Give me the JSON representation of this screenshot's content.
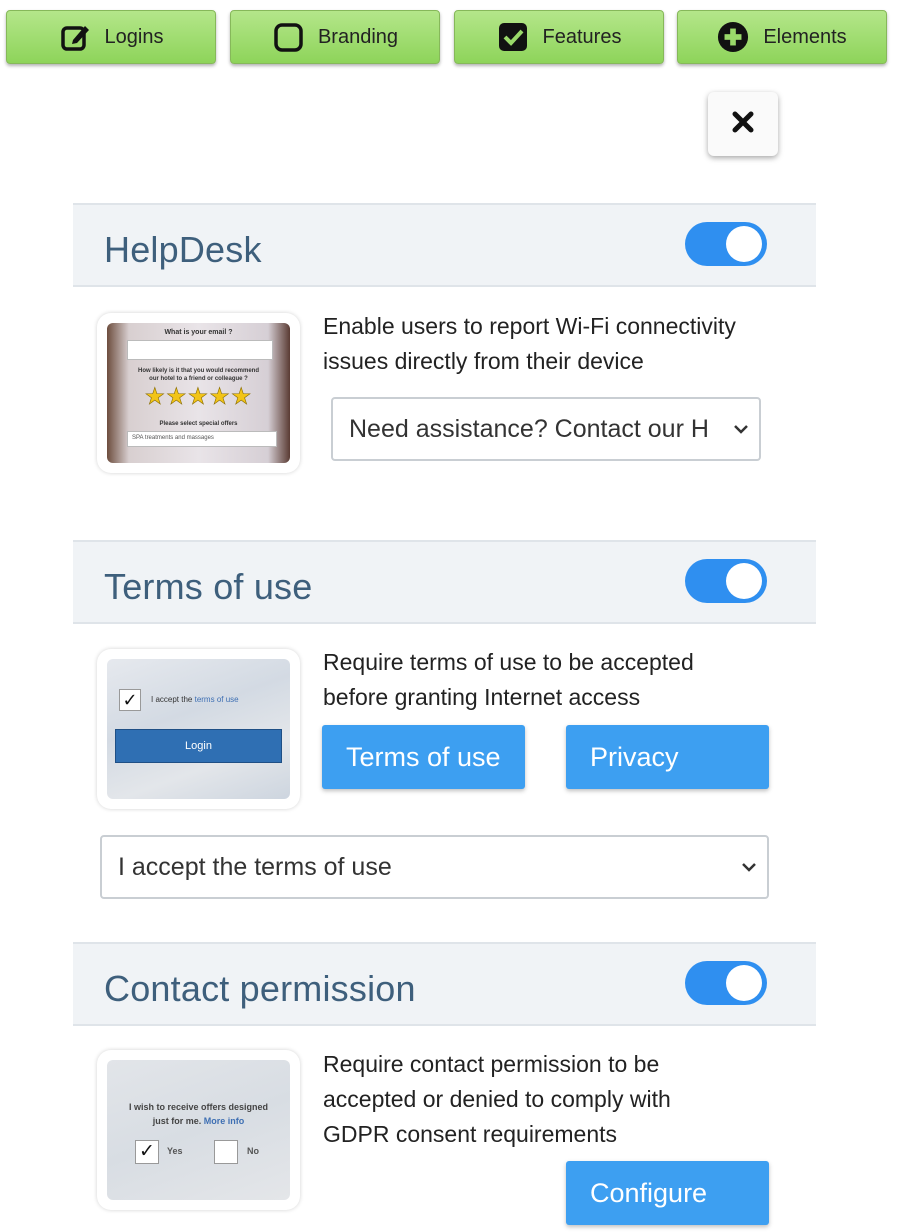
{
  "tabs": [
    {
      "label": "Logins",
      "icon": "edit-icon"
    },
    {
      "label": "Branding",
      "icon": "square-icon"
    },
    {
      "label": "Features",
      "icon": "checkbox-icon"
    },
    {
      "label": "Elements",
      "icon": "plus-circle-icon"
    }
  ],
  "close": {
    "icon": "close-icon"
  },
  "sections": {
    "helpdesk": {
      "title": "HelpDesk",
      "enabled": true,
      "description_line1": "Enable users to report Wi-Fi connectivity",
      "description_line2": "issues directly from their device",
      "select_value": "Need assistance? Contact our H",
      "preview": {
        "q1": "What is your email ?",
        "q2": "How likely is it that you would recommend",
        "q2b": "our hotel to a friend or colleague ?",
        "stars": "★★★★★",
        "q3": "Please select special offers",
        "select": "SPA treatments and massages"
      }
    },
    "terms": {
      "title": "Terms of use",
      "enabled": true,
      "description_line1": "Require terms of use to be accepted",
      "description_line2": "before granting Internet access",
      "terms_button": "Terms of use",
      "privacy_button": "Privacy",
      "select_value": "I accept the terms of use",
      "preview": {
        "accept_text": "I accept the",
        "accept_link": "terms of use",
        "login": "Login"
      }
    },
    "contact": {
      "title": "Contact permission",
      "enabled": true,
      "description_line1": "Require contact permission to be",
      "description_line2": "accepted or denied to comply with",
      "description_line3": "GDPR consent requirements",
      "configure_button": "Configure",
      "preview": {
        "line1": "I wish to receive offers designed",
        "line2": "just for me.",
        "more_info": "More info",
        "yes": "Yes",
        "no": "No"
      }
    }
  },
  "colors": {
    "tab_green": "#9ad96a",
    "toggle_blue": "#2f8ff0",
    "button_blue": "#3d9ff1",
    "title_blue": "#3e5f7c",
    "header_bg": "#f0f3f6"
  }
}
